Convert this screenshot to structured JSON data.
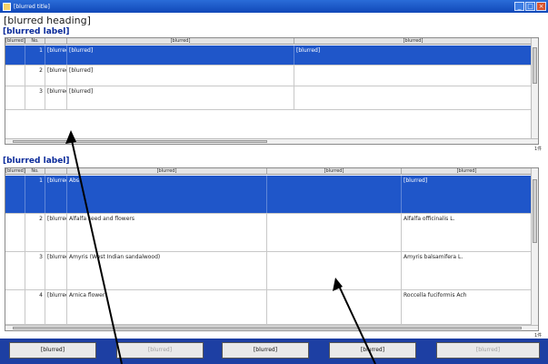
{
  "window": {
    "title": "[blurred title]"
  },
  "page": {
    "title": "[blurred heading]"
  },
  "sections": {
    "top": {
      "label": "[blurred label]"
    },
    "bottom": {
      "label": "[blurred label]"
    }
  },
  "top_grid": {
    "headers": [
      "[blurred]",
      "No.",
      "[blurred]",
      "[blurred]"
    ],
    "rows": [
      {
        "num": "1",
        "code": "[blurred]",
        "name": "[blurred]",
        "note": "[blurred]"
      },
      {
        "num": "2",
        "code": "[blurred]",
        "name": "[blurred]",
        "note": ""
      },
      {
        "num": "3",
        "code": "[blurred]",
        "name": "[blurred]",
        "note": ""
      }
    ],
    "count": "1件"
  },
  "bottom_grid": {
    "headers": [
      "[blurred]",
      "No.",
      "[blurred]",
      "[blurred]",
      "[blurred]"
    ],
    "rows": [
      {
        "num": "1",
        "code": "[blurred]",
        "name": "Abs",
        "mid": "",
        "sci": "[blurred]"
      },
      {
        "num": "2",
        "code": "[blurred]",
        "name": "Alfalfa seed and flowers",
        "mid": "",
        "sci": "Alfalfa officinalis L."
      },
      {
        "num": "3",
        "code": "[blurred]",
        "name": "Amyris (West Indian sandalwood)",
        "mid": "",
        "sci": "Amyris balsamifera L."
      },
      {
        "num": "4",
        "code": "[blurred]",
        "name": "Arnica flower",
        "mid": "",
        "sci": "Roccella fuciformis Ach"
      }
    ],
    "count": "1件"
  },
  "buttons": {
    "b1": "[blurred]",
    "b2": "[blurred]",
    "b3": "[blurred]",
    "b4": "[blurred]",
    "b5": "[blurred]"
  },
  "colors": {
    "titlebar": "#1148b8",
    "selection": "#1f56c9",
    "bottombar": "#1d3fa3"
  },
  "icons": {
    "app": "app-icon",
    "minimize": "minimize-icon",
    "maximize": "maximize-icon",
    "close": "close-icon"
  }
}
